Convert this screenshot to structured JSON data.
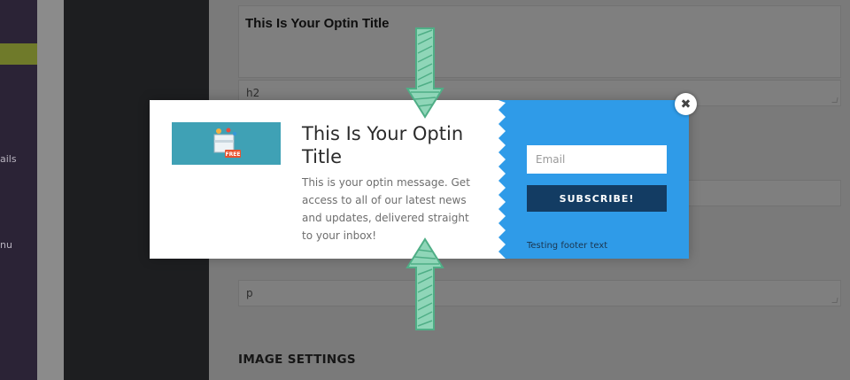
{
  "background": {
    "sidebar_labels": [
      "ails",
      "nu"
    ],
    "title_field_text": "This Is Your Optin Title",
    "title_tag_value": "h2",
    "message_tag_value": "p",
    "section_heading": "IMAGE SETTINGS"
  },
  "popup": {
    "image_badge_text": "FREE",
    "title": "This Is Your Optin Title",
    "message": "This is your optin message. Get access to all of our latest news and updates, delivered straight to your inbox!",
    "email_placeholder": "Email",
    "subscribe_label": "SUBSCRIBE!",
    "footer_text": "Testing footer text",
    "close_glyph": "✖"
  },
  "colors": {
    "accent_blue": "#2f9be8",
    "button_navy": "#133c63",
    "image_teal": "#3fa1b5",
    "arrow_green": "#5fbf97"
  }
}
